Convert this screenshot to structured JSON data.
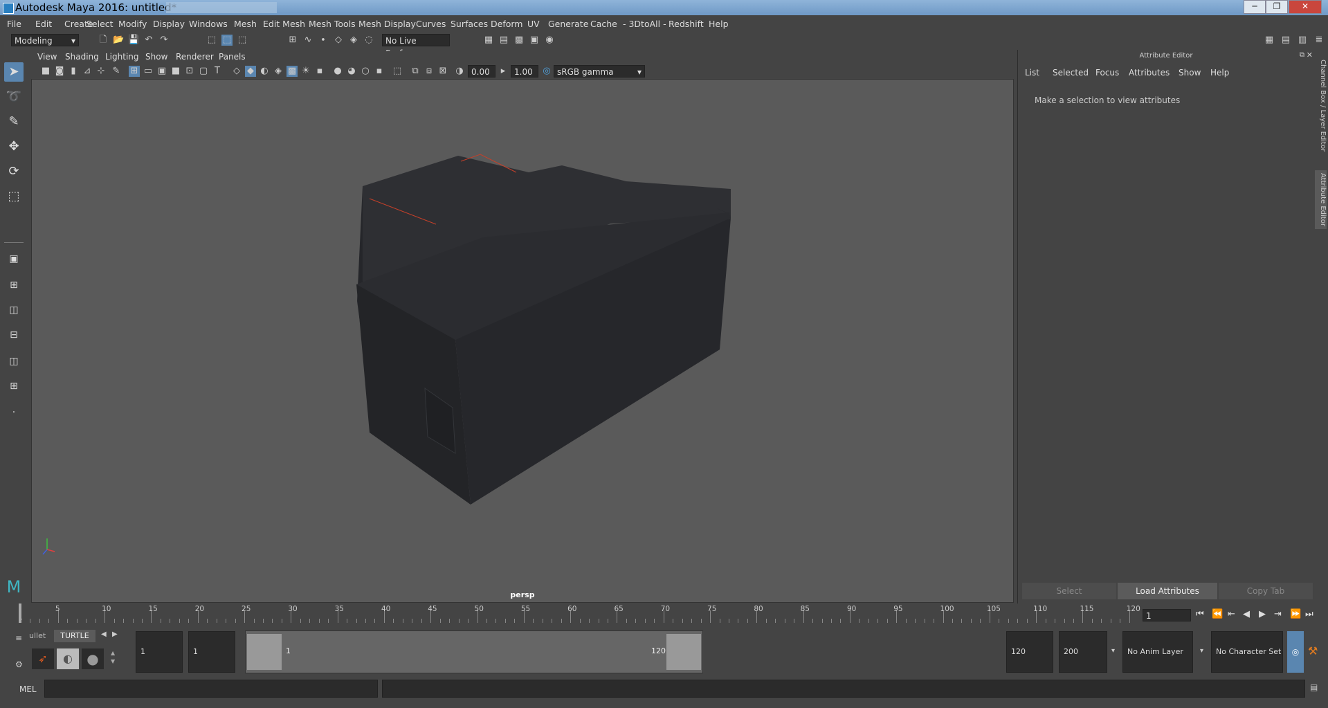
{
  "window": {
    "title": "Autodesk Maya 2016: untitled*"
  },
  "menu": [
    "File",
    "Edit",
    "Create",
    "Select",
    "Modify",
    "Display",
    "Windows",
    "Mesh",
    "Edit Mesh",
    "Mesh Tools",
    "Mesh Display",
    "Curves",
    "Surfaces",
    "Deform",
    "UV",
    "Generate",
    "Cache",
    "- 3DtoAll -",
    "Redshift",
    "Help"
  ],
  "shelf": {
    "mode": "Modeling",
    "live_surface": "No Live Surface"
  },
  "viewport": {
    "menu": [
      "View",
      "Shading",
      "Lighting",
      "Show",
      "Renderer",
      "Panels"
    ],
    "exposure": "0.00",
    "gamma": "1.00",
    "color_space": "sRGB gamma",
    "camera": "persp"
  },
  "attribute_editor": {
    "title": "Attribute Editor",
    "menu": [
      "List",
      "Selected",
      "Focus",
      "Attributes",
      "Show",
      "Help"
    ],
    "message": "Make a selection to view attributes",
    "buttons": {
      "select": "Select",
      "load": "Load Attributes",
      "copy": "Copy Tab"
    }
  },
  "side_tabs": {
    "channel_box": "Channel Box / Layer Editor",
    "attribute_editor": "Attribute Editor"
  },
  "timeline": {
    "ticks": [
      "5",
      "10",
      "15",
      "20",
      "25",
      "30",
      "35",
      "40",
      "45",
      "50",
      "55",
      "60",
      "65",
      "70",
      "75",
      "80",
      "85",
      "90",
      "95",
      "100",
      "105",
      "110",
      "115",
      "120"
    ],
    "start_label": "1",
    "current_frame": "1"
  },
  "range": {
    "shelf_tabs": {
      "bullet": "ullet",
      "turtle": "TURTLE"
    },
    "start": "1",
    "playback_start": "1",
    "slider_start": "1",
    "slider_end": "120",
    "playback_end": "120",
    "end": "200",
    "anim_layer": "No Anim Layer",
    "character_set": "No Character Set"
  },
  "command_line": {
    "label": "MEL"
  }
}
